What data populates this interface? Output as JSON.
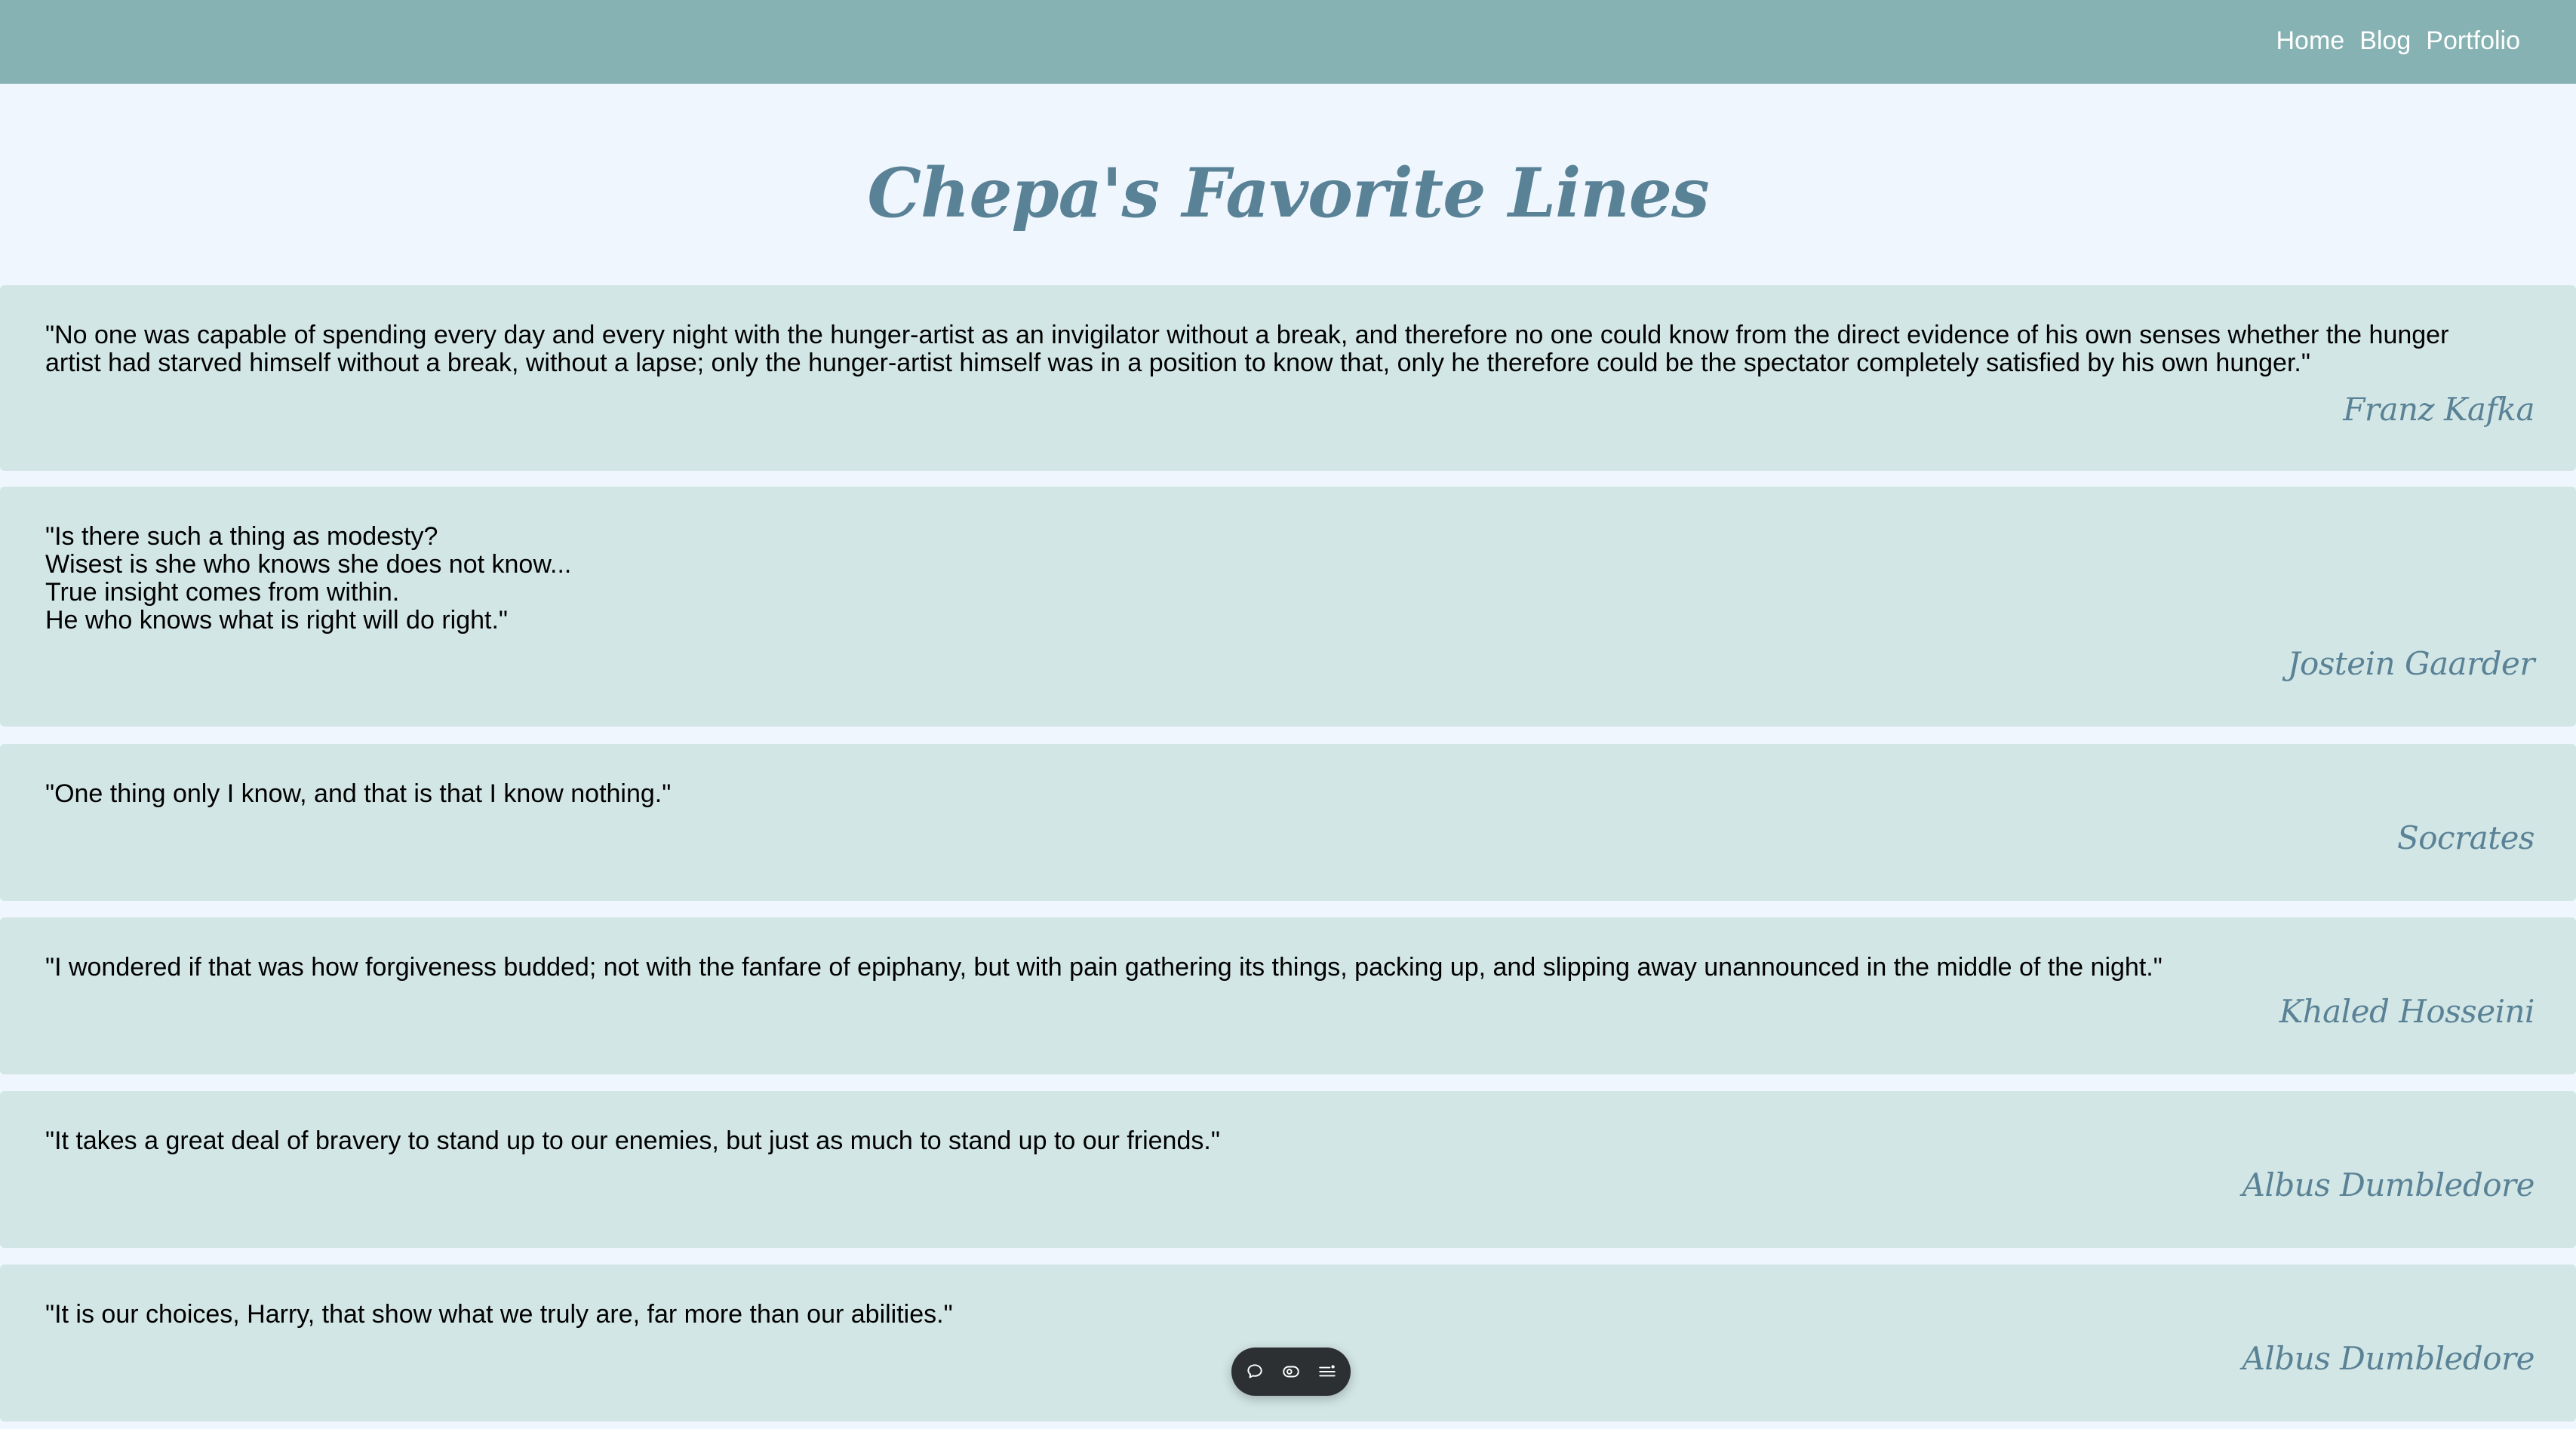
{
  "nav": {
    "items": [
      {
        "label": "Home"
      },
      {
        "label": "Blog"
      },
      {
        "label": "Portfolio"
      }
    ]
  },
  "page": {
    "title": "Chepa's Favorite Lines"
  },
  "quotes": [
    {
      "text": "\"No one was capable of spending every day and every night with the hunger-artist as an invigilator without a break, and therefore no one could know from the direct evidence of his own senses whether the hunger artist had starved himself without a break, without a lapse; only the hunger-artist himself was in a position to know that, only he therefore could be the spectator completely satisfied by his own hunger.\"",
      "author": "Franz Kafka"
    },
    {
      "text": "\"Is there such a thing as modesty?\nWisest is she who knows she does not know...\nTrue insight comes from within.\nHe who knows what is right will do right.\"",
      "author": "Jostein Gaarder"
    },
    {
      "text": "\"One thing only I know, and that is that I know nothing.\"",
      "author": "Socrates"
    },
    {
      "text": "\"I wondered if that was how forgiveness budded; not with the fanfare of epiphany, but with pain gathering its things, packing up, and slipping away unannounced in the middle of the night.\"",
      "author": "Khaled Hosseini"
    },
    {
      "text": "\"It takes a great deal of bravery to stand up to our enemies, but just as much to stand up to our friends.\"",
      "author": "Albus Dumbledore"
    },
    {
      "text": "\"It is our choices, Harry, that show what we truly are, far more than our abilities.\"",
      "author": "Albus Dumbledore"
    }
  ],
  "toolbar": {
    "icons": [
      "comment-icon",
      "eye-icon",
      "list-icon"
    ]
  },
  "colors": {
    "header_bg": "#86b2b3",
    "page_bg": "#eff6fd",
    "card_bg": "#d2e6e5",
    "title_color": "#5a8296"
  }
}
